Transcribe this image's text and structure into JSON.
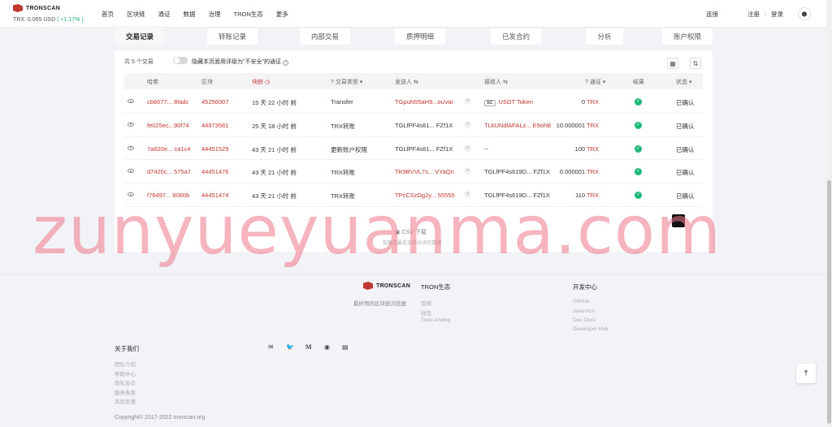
{
  "header": {
    "logo_text": "TRONSCAN",
    "price_label": "TRX: 0.065 USD",
    "price_change": "( +1.17% )",
    "nav": [
      "首页",
      "区块链",
      "通证",
      "数据",
      "治理",
      "TRON生态",
      "更多"
    ],
    "connect": "连接",
    "register": "注册",
    "separator": "|",
    "login": "登录",
    "cube_icon": "cube-icon"
  },
  "tabs": [
    "交易记录",
    "转账记录",
    "内部交易",
    "质押明细",
    "已发合约",
    "分析",
    "账户权限"
  ],
  "panel": {
    "count": "共 5 个交易",
    "toggle_label": "隐藏本页面用评级为\"不安全\"的通证",
    "help": "?",
    "calendar_icon": "calendar-icon",
    "filter_icon": "sort-icon",
    "columns": [
      "哈希",
      "区块",
      "块龄",
      "交易类型",
      "发送人",
      "接收人",
      "通证",
      "结果",
      "状态"
    ],
    "rows": [
      {
        "hash": "cb8077... 8fadc",
        "block": "45256007",
        "age": "15 天 22 小时 前",
        "type": "Transfer",
        "from": "TGpuN55aH9...ouVai",
        "to": "USDT Token",
        "to_badge": "SC",
        "amount": "0",
        "token": "TRX",
        "status": "已确认"
      },
      {
        "hash": "fe025ec...90f74",
        "block": "44973581",
        "age": "25 天 18 小时 前",
        "type": "TRX转账",
        "from": "TGLfPF4s61... FZf1X",
        "to": "TLkUNdlAFALz... E9ohB",
        "to_badge": "",
        "amount": "10.000001",
        "token": "TRX",
        "status": "已确认"
      },
      {
        "hash": "7a620e... ca1c4",
        "block": "44451529",
        "age": "43 天 21 小时 前",
        "type": "更新账户权限",
        "from": "TGLfPF4s61... FZf1X",
        "to": "--",
        "to_badge": "",
        "amount": "100",
        "token": "TRX",
        "status": "已确认"
      },
      {
        "hash": "d7420c... 575a7",
        "block": "44451476",
        "age": "43 天 21 小时 前",
        "type": "TRX转账",
        "from": "TK9BVVL7s... VYaQn",
        "to": "TGLfPF4s619D... FZf1X",
        "to_badge": "",
        "amount": "0.000001",
        "token": "TRX",
        "status": "已确认"
      },
      {
        "hash": "f76497... 8060b",
        "block": "44451474",
        "age": "43 天 21 小时 前",
        "type": "TRX转账",
        "from": "TPcCSzDg2y... 55555",
        "to": "TGLfPF4s619D... FZf1X",
        "to_badge": "",
        "amount": "110",
        "token": "TRX",
        "status": "已确认"
      }
    ],
    "download": "CSV 下载",
    "download_note": "仅展示最近支持30天的数据"
  },
  "footer": {
    "tagline": "最好用的区块链浏览器",
    "eco_title": "TRON生态",
    "eco_links": [
      "官网",
      "钱包",
      "TronLending"
    ],
    "dev_title": "开发中心",
    "dev_links": [
      "GitHub",
      "Java-tron",
      "Dev Docs",
      "Developer Hub"
    ],
    "about_title": "关于我们",
    "about_links": [
      "团队介绍",
      "帮助中心",
      "隐私协议",
      "服务条款",
      "风险反馈"
    ],
    "socials": [
      "✉",
      "🐦",
      "M",
      "◉",
      "▤"
    ],
    "copyright": "Copyright© 2017-2022 tronscan.org"
  },
  "watermark": "zunyueyuanma.com",
  "colors": {
    "brand": "#c23631",
    "positive": "#19b27a",
    "success": "#20b87a"
  }
}
